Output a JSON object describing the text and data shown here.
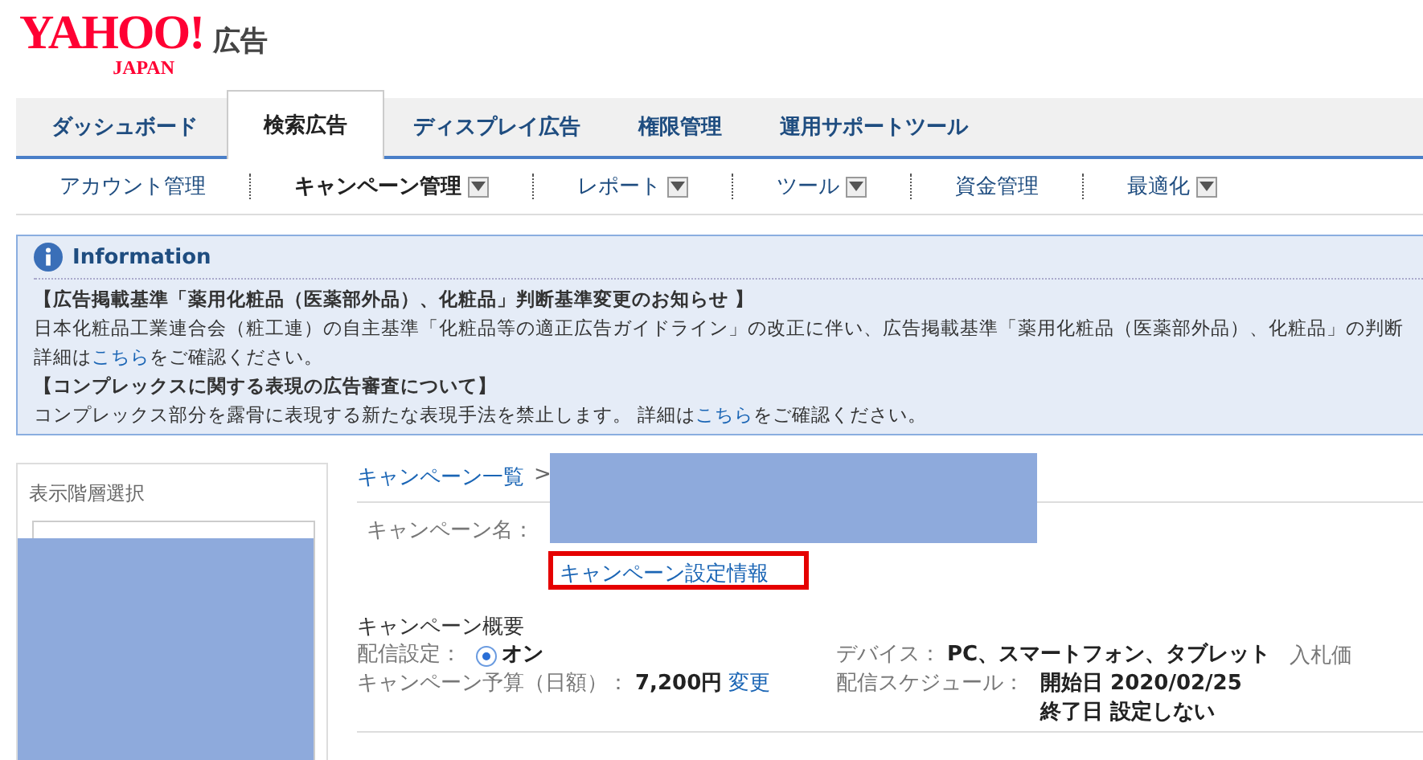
{
  "header": {
    "logo": "YAHOO!",
    "logo_sub": "JAPAN",
    "service": "広告"
  },
  "tabs": [
    {
      "label": "ダッシュボード",
      "selected": false
    },
    {
      "label": "検索広告",
      "selected": true
    },
    {
      "label": "ディスプレイ広告",
      "selected": false
    },
    {
      "label": "権限管理",
      "selected": false
    },
    {
      "label": "運用サポートツール",
      "selected": false
    }
  ],
  "subnav": [
    {
      "label": "アカウント管理",
      "selected": false,
      "dropdown": false
    },
    {
      "label": "キャンペーン管理",
      "selected": true,
      "dropdown": true
    },
    {
      "label": "レポート",
      "selected": false,
      "dropdown": true
    },
    {
      "label": "ツール",
      "selected": false,
      "dropdown": true
    },
    {
      "label": "資金管理",
      "selected": false,
      "dropdown": false
    },
    {
      "label": "最適化",
      "selected": false,
      "dropdown": true
    }
  ],
  "information": {
    "title": "Information",
    "lines": [
      {
        "kind": "heading",
        "text": "【広告掲載基準「薬用化粧品（医薬部外品）、化粧品」判断基準変更のお知らせ 】"
      },
      {
        "kind": "text",
        "text": "日本化粧品工業連合会（粧工連）の自主基準「化粧品等の適正広告ガイドライン」の改正に伴い、広告掲載基準「薬用化粧品（医薬部外品）、化粧品」の判断"
      },
      {
        "kind": "link",
        "before": "詳細は",
        "link": "こちら",
        "after": "をご確認ください。"
      },
      {
        "kind": "heading",
        "text": "【コンプレックスに関する表現の広告審査について】"
      },
      {
        "kind": "link",
        "before": "コンプレックス部分を露骨に表現する新たな表現手法を禁止します。 詳細は",
        "link": "こちら",
        "after": "をご確認ください。"
      }
    ]
  },
  "sidebar": {
    "title": "表示階層選択"
  },
  "breadcrumb": {
    "link": "キャンペーン一覧",
    "separator": ">"
  },
  "campaign_name": {
    "label": "キャンペーン名："
  },
  "settings_link": "キャンペーン設定情報",
  "overview": {
    "title": "キャンペーン概要",
    "delivery": {
      "label": "配信設定：",
      "value": "オン",
      "selected": true
    },
    "budget": {
      "label": "キャンペーン予算（日額）：",
      "value": "7,200円",
      "link": "変更"
    },
    "device": {
      "label": "デバイス：",
      "value": "PC、スマートフォン、タブレット"
    },
    "schedule": {
      "label": "配信スケジュール：",
      "start": "開始日 2020/02/25",
      "end": "終了日 設定しない"
    },
    "column_3": {
      "label": "入札価"
    }
  }
}
